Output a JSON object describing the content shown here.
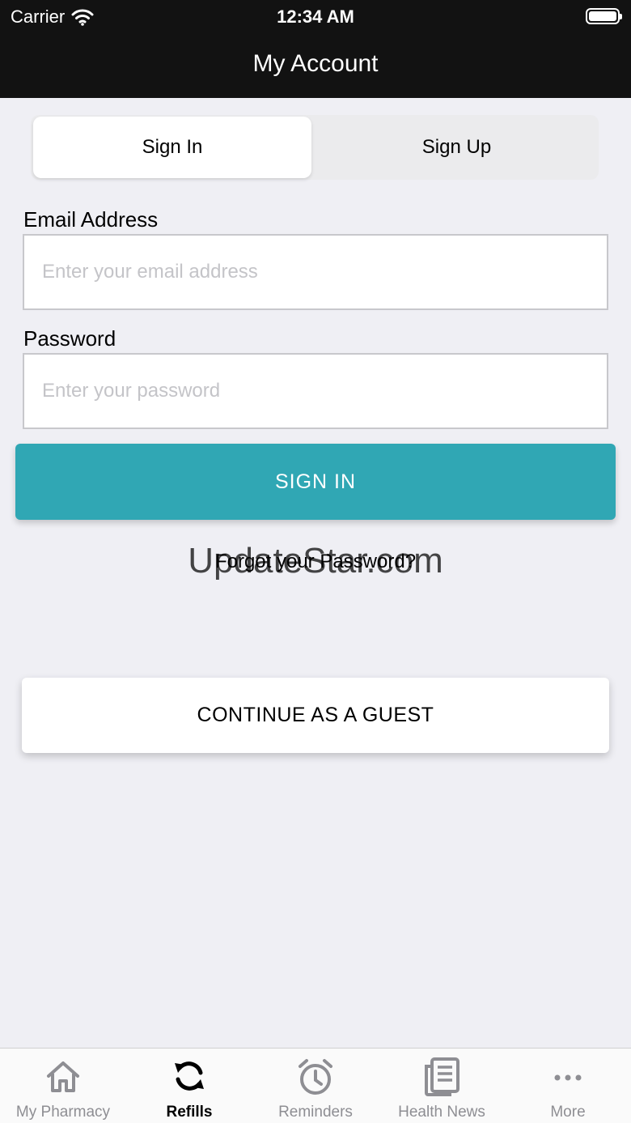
{
  "status_bar": {
    "carrier": "Carrier",
    "time": "12:34 AM"
  },
  "nav": {
    "title": "My Account"
  },
  "segment": {
    "sign_in": "Sign In",
    "sign_up": "Sign Up"
  },
  "form": {
    "email_label": "Email Address",
    "email_placeholder": "Enter your email address",
    "password_label": "Password",
    "password_placeholder": "Enter your password"
  },
  "buttons": {
    "sign_in": "SIGN IN",
    "forgot": "Forgot your Password?",
    "guest": "CONTINUE AS A GUEST"
  },
  "watermark": "UpdateStar.com",
  "colors": {
    "accent": "#30a7b4",
    "nav_background": "#121212",
    "page_background": "#efeff4"
  },
  "tabs": [
    {
      "label": "My Pharmacy",
      "icon": "home-icon"
    },
    {
      "label": "Refills",
      "icon": "refresh-icon",
      "selected": true
    },
    {
      "label": "Reminders",
      "icon": "alarm-clock-icon"
    },
    {
      "label": "Health News",
      "icon": "newspaper-icon"
    },
    {
      "label": "More",
      "icon": "more-dots-icon"
    }
  ]
}
